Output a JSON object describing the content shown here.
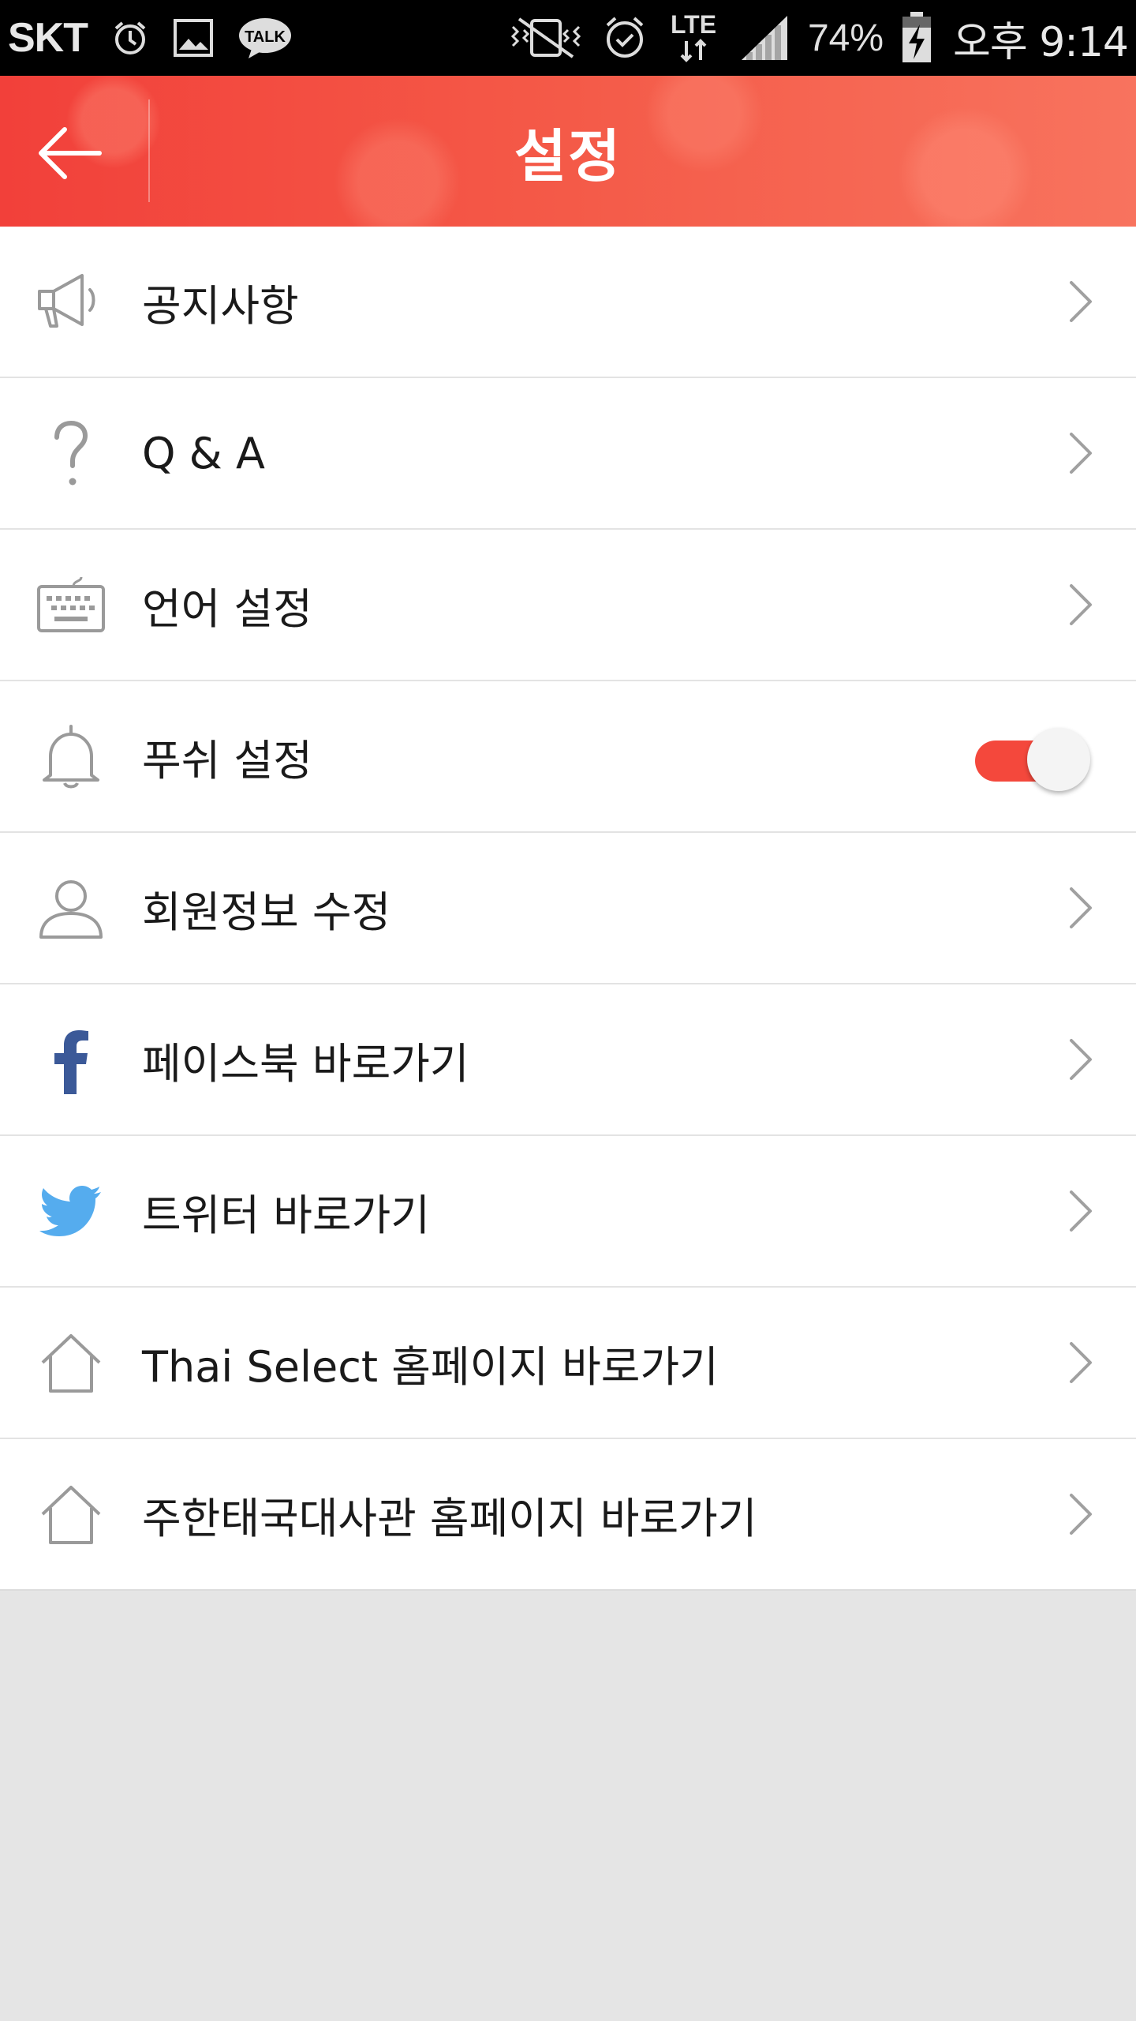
{
  "status_bar": {
    "carrier": "SKT",
    "battery_percent": "74%",
    "network": "LTE",
    "time": "오후 9:14",
    "icons": [
      "alarm-icon",
      "gallery-icon",
      "kakaotalk-icon",
      "vibrate-icon",
      "alarm-icon",
      "lte-icon",
      "signal-icon",
      "battery-charging-icon"
    ],
    "kakao_badge": "TALK"
  },
  "app_bar": {
    "title": "설정",
    "back_icon": "arrow-left-icon",
    "background_color": "#f4483c"
  },
  "menu": {
    "items": [
      {
        "label": "공지사항",
        "icon": "megaphone-icon",
        "action": "chevron"
      },
      {
        "label": "Q & A",
        "icon": "question-icon",
        "action": "chevron"
      },
      {
        "label": "언어 설정",
        "icon": "keyboard-icon",
        "action": "chevron"
      },
      {
        "label": "푸쉬 설정",
        "icon": "bell-icon",
        "action": "toggle",
        "toggle_on": true
      },
      {
        "label": "회원정보 수정",
        "icon": "user-icon",
        "action": "chevron"
      },
      {
        "label": "페이스북 바로가기",
        "icon": "facebook-icon",
        "action": "chevron"
      },
      {
        "label": "트위터 바로가기",
        "icon": "twitter-icon",
        "action": "chevron"
      },
      {
        "label": "Thai Select 홈페이지 바로가기",
        "icon": "home-icon",
        "action": "chevron"
      },
      {
        "label": "주한태국대사관 홈페이지 바로가기",
        "icon": "home-icon",
        "action": "chevron"
      }
    ]
  },
  "colors": {
    "accent": "#f4483c",
    "facebook": "#3b5998",
    "twitter": "#55acee",
    "icon_gray": "#9a9a9a",
    "chevron_gray": "#a0a0a0",
    "page_background": "#e5e5e5"
  }
}
